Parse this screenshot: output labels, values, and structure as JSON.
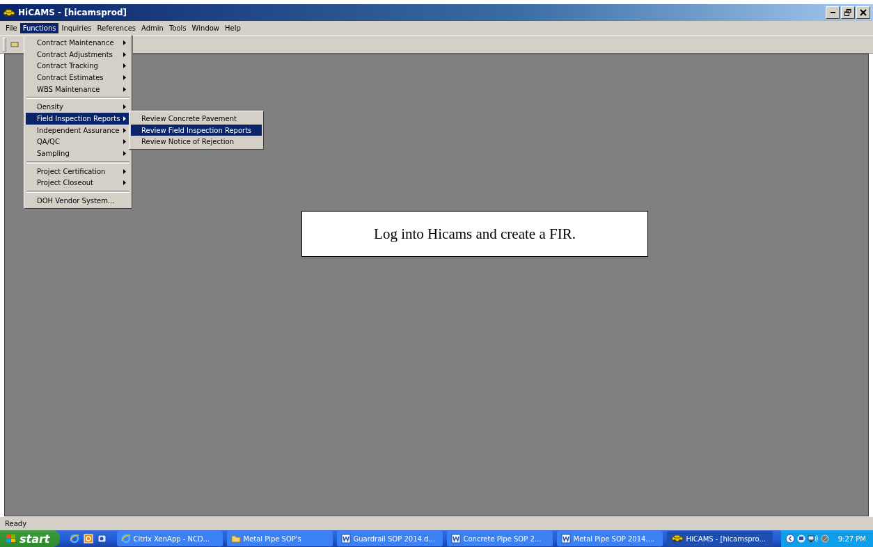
{
  "window": {
    "title": "HiCAMS - [hicamsprod]"
  },
  "menubar": [
    {
      "label": "File",
      "selected": false
    },
    {
      "label": "Functions",
      "selected": true
    },
    {
      "label": "Inquiries",
      "selected": false
    },
    {
      "label": "References",
      "selected": false
    },
    {
      "label": "Admin",
      "selected": false
    },
    {
      "label": "Tools",
      "selected": false
    },
    {
      "label": "Window",
      "selected": false
    },
    {
      "label": "Help",
      "selected": false
    }
  ],
  "functions_menu": {
    "groups": [
      [
        {
          "label": "Contract Maintenance",
          "submenu": true,
          "selected": false
        },
        {
          "label": "Contract Adjustments",
          "submenu": true,
          "selected": false
        },
        {
          "label": "Contract Tracking",
          "submenu": true,
          "selected": false
        },
        {
          "label": "Contract Estimates",
          "submenu": true,
          "selected": false
        },
        {
          "label": "WBS Maintenance",
          "submenu": true,
          "selected": false
        }
      ],
      [
        {
          "label": "Density",
          "submenu": true,
          "selected": false
        },
        {
          "label": "Field Inspection Reports",
          "submenu": true,
          "selected": true
        },
        {
          "label": "Independent Assurance",
          "submenu": true,
          "selected": false
        },
        {
          "label": "QA/QC",
          "submenu": true,
          "selected": false
        },
        {
          "label": "Sampling",
          "submenu": true,
          "selected": false
        }
      ],
      [
        {
          "label": "Project Certification",
          "submenu": true,
          "selected": false
        },
        {
          "label": "Project Closeout",
          "submenu": true,
          "selected": false
        }
      ],
      [
        {
          "label": "DOH Vendor System...",
          "submenu": false,
          "selected": false
        }
      ]
    ]
  },
  "submenu": [
    {
      "label": "Review Concrete Pavement",
      "selected": false
    },
    {
      "label": "Review Field Inspection Reports",
      "selected": true
    },
    {
      "label": "Review Notice of Rejection",
      "selected": false
    }
  ],
  "callout": {
    "text": "Log into Hicams and create a FIR."
  },
  "status_bar": {
    "text": "Ready"
  },
  "taskbar": {
    "start": "start",
    "tasks": [
      {
        "kind": "browser",
        "label": "Citrix XenApp - NCD...",
        "selected": false
      },
      {
        "kind": "folder",
        "label": "Metal Pipe SOP's",
        "selected": false
      },
      {
        "kind": "word",
        "label": "Guardrail SOP 2014.d...",
        "selected": false
      },
      {
        "kind": "word",
        "label": "Concrete Pipe SOP 2...",
        "selected": false
      },
      {
        "kind": "word",
        "label": "Metal Pipe SOP 2014....",
        "selected": false
      },
      {
        "kind": "app",
        "label": "HiCAMS - [hicamspro...",
        "selected": true
      }
    ],
    "clock": "9:27 PM"
  }
}
